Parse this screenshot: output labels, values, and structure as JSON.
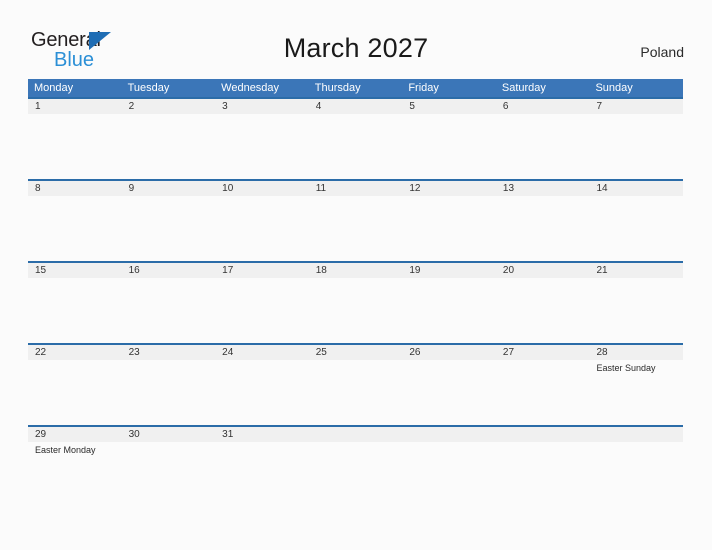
{
  "brand": {
    "name_part1": "General",
    "name_part2": "Blue",
    "flag_icon": "blue-triangle-flag",
    "accent_dark": "#231f20",
    "accent_blue": "#2b8fd6",
    "flag_blue": "#1f6db4"
  },
  "header": {
    "title": "March 2027",
    "country": "Poland"
  },
  "colors": {
    "weekday_header_bg": "#3b76b8",
    "date_band_bg": "#f0f0f0",
    "row_separator": "#2b6ca8",
    "page_bg": "#fbfbfb"
  },
  "calendar": {
    "weekdays": [
      "Monday",
      "Tuesday",
      "Wednesday",
      "Thursday",
      "Friday",
      "Saturday",
      "Sunday"
    ],
    "weeks": [
      {
        "dates": [
          "1",
          "2",
          "3",
          "4",
          "5",
          "6",
          "7"
        ],
        "events": [
          "",
          "",
          "",
          "",
          "",
          "",
          ""
        ]
      },
      {
        "dates": [
          "8",
          "9",
          "10",
          "11",
          "12",
          "13",
          "14"
        ],
        "events": [
          "",
          "",
          "",
          "",
          "",
          "",
          ""
        ]
      },
      {
        "dates": [
          "15",
          "16",
          "17",
          "18",
          "19",
          "20",
          "21"
        ],
        "events": [
          "",
          "",
          "",
          "",
          "",
          "",
          ""
        ]
      },
      {
        "dates": [
          "22",
          "23",
          "24",
          "25",
          "26",
          "27",
          "28"
        ],
        "events": [
          "",
          "",
          "",
          "",
          "",
          "",
          "Easter Sunday"
        ]
      },
      {
        "dates": [
          "29",
          "30",
          "31",
          "",
          "",
          "",
          ""
        ],
        "events": [
          "Easter Monday",
          "",
          "",
          "",
          "",
          "",
          ""
        ]
      }
    ]
  }
}
